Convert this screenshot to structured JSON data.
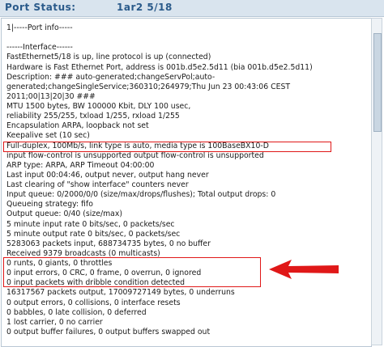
{
  "header": {
    "title": "Port Status:",
    "port": "1ar2 5/18"
  },
  "output_lines": [
    "1|-----Port info-----",
    "",
    "------Interface------",
    "FastEthernet5/18 is up, line protocol is up (connected)",
    "Hardware is Fast Ethernet Port, address is 001b.d5e2.5d11 (bia 001b.d5e2.5d11)",
    "Description: ### auto-generated;changeServPol;auto-",
    "generated;changeSingleService;360310;264979;Thu Jun 23 00:43:06 CEST",
    "2011;00|13|20|30 ###",
    "MTU 1500 bytes, BW 100000 Kbit, DLY 100 usec,",
    "reliability 255/255, txload 1/255, rxload 1/255",
    "Encapsulation ARPA, loopback not set",
    "Keepalive set (10 sec)",
    "Full-duplex, 100Mb/s, link type is auto, media type is 100BaseBX10-D",
    "input flow-control is unsupported output flow-control is unsupported",
    "ARP type: ARPA, ARP Timeout 04:00:00",
    "Last input 00:04:46, output never, output hang never",
    "Last clearing of \"show interface\" counters never",
    "Input queue: 0/2000/0/0 (size/max/drops/flushes); Total output drops: 0",
    "Queueing strategy: fifo",
    "Output queue: 0/40 (size/max)",
    "5 minute input rate 0 bits/sec, 0 packets/sec",
    "5 minute output rate 0 bits/sec, 0 packets/sec",
    "5283063 packets input, 688734735 bytes, 0 no buffer",
    "Received 9379 broadcasts (0 multicasts)",
    "0 runts, 0 giants, 0 throttles",
    "0 input errors, 0 CRC, 0 frame, 0 overrun, 0 ignored",
    "0 input packets with dribble condition detected",
    "16317567 packets output, 17009727149 bytes, 0 underruns",
    "0 output errors, 0 collisions, 0 interface resets",
    "0 babbles, 0 late collision, 0 deferred",
    "1 lost carrier, 0 no carrier",
    "0 output buffer failures, 0 output buffers swapped out"
  ],
  "colors": {
    "header_bg": "#d9e4ee",
    "header_text": "#2a5a8a",
    "highlight": "#e01818"
  }
}
